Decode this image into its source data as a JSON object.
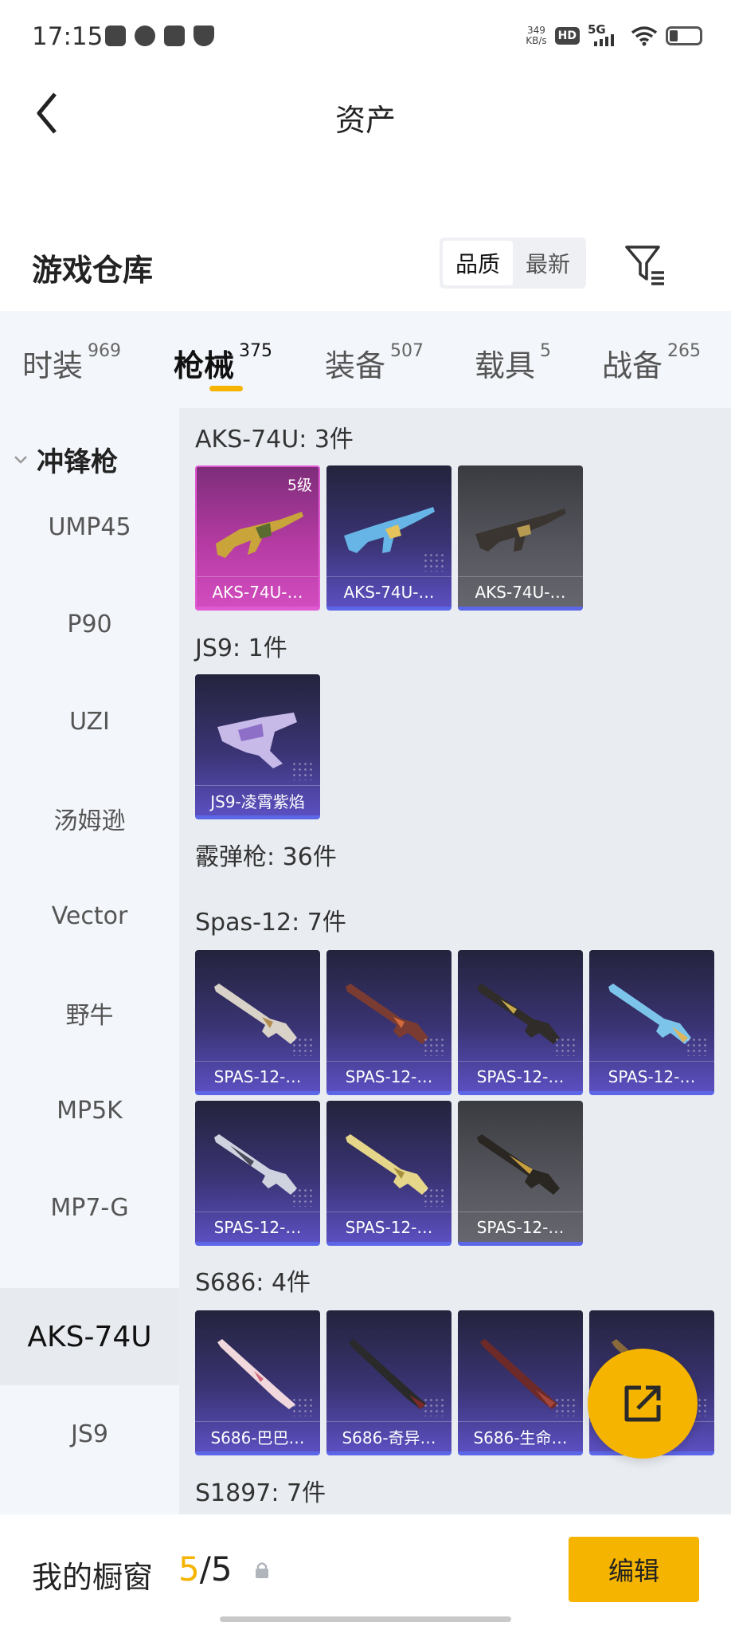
{
  "status_bar": {
    "time": "17:15",
    "net_speed_value": "349",
    "net_speed_unit": "KB/s",
    "hd": "HD",
    "network": "5G",
    "icons": [
      "message-icon",
      "cat-app-icon",
      "app-icon",
      "shield-icon"
    ]
  },
  "header": {
    "title": "资产"
  },
  "warehouse": {
    "title": "游戏仓库",
    "sort_options": [
      "品质",
      "最新"
    ],
    "active_sort": "品质"
  },
  "categories": [
    {
      "label": "时装",
      "count": "969"
    },
    {
      "label": "枪械",
      "count": "375",
      "active": true
    },
    {
      "label": "装备",
      "count": "507"
    },
    {
      "label": "载具",
      "count": "5"
    },
    {
      "label": "战备",
      "count": "265"
    }
  ],
  "sidebar": {
    "group": "冲锋枪",
    "items": [
      "UMP45",
      "P90",
      "UZI",
      "汤姆逊",
      "Vector",
      "野牛",
      "MP5K",
      "MP7-G",
      "AKS-74U",
      "JS9"
    ],
    "active_item": "AKS-74U"
  },
  "sections": [
    {
      "title": "AKS-74U: 3件",
      "items": [
        {
          "caption": "AKS-74U-…",
          "level": "5级",
          "quality": "gold"
        },
        {
          "caption": "AKS-74U-…",
          "quality": "purple"
        },
        {
          "caption": "AKS-74U-…",
          "quality": "grey"
        }
      ]
    },
    {
      "title": "JS9: 1件",
      "items": [
        {
          "caption": "JS9-凌霄紫焰",
          "quality": "purple"
        }
      ]
    },
    {
      "title": "霰弹枪: 36件"
    },
    {
      "title": "Spas-12: 7件",
      "items": [
        {
          "caption": "SPAS-12-…",
          "quality": "purple"
        },
        {
          "caption": "SPAS-12-…",
          "quality": "purple"
        },
        {
          "caption": "SPAS-12-…",
          "quality": "purple"
        },
        {
          "caption": "SPAS-12-…",
          "quality": "purple"
        },
        {
          "caption": "SPAS-12-…",
          "quality": "purple"
        },
        {
          "caption": "SPAS-12-…",
          "quality": "purple"
        },
        {
          "caption": "SPAS-12-…",
          "quality": "grey"
        }
      ]
    },
    {
      "title": "S686: 4件",
      "items": [
        {
          "caption": "S686-巴巴…",
          "quality": "purple"
        },
        {
          "caption": "S686-奇异…",
          "quality": "purple"
        },
        {
          "caption": "S686-生命…",
          "quality": "purple"
        },
        {
          "caption": "…",
          "quality": "purple"
        }
      ]
    },
    {
      "title": "S1897: 7件"
    }
  ],
  "showcase": {
    "label": "我的橱窗",
    "current": "5",
    "separator": "/",
    "total": "5",
    "edit_label": "编辑"
  },
  "colors": {
    "accent": "#f5b400",
    "content_bg": "#e9edf2",
    "sidebar_bg": "#f3f6fa",
    "card_underline": "#5c67e8"
  }
}
